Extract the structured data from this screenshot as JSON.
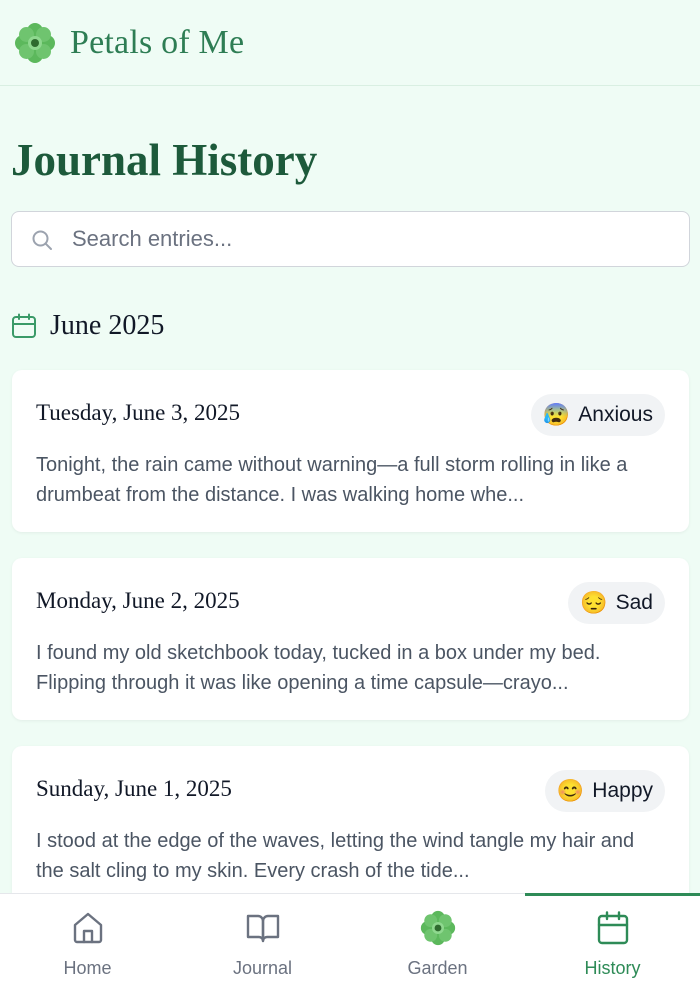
{
  "app": {
    "title": "Petals of Me",
    "logo_icon": "flower-icon"
  },
  "page": {
    "title": "Journal History"
  },
  "search": {
    "placeholder": "Search entries...",
    "value": ""
  },
  "month": {
    "label": "June 2025"
  },
  "entries": [
    {
      "date": "Tuesday, June 3, 2025",
      "mood": {
        "emoji": "😰",
        "label": "Anxious"
      },
      "excerpt_line1": "Tonight, the rain came without warning—a full storm rolling in like a",
      "excerpt_line2": "drumbeat from the distance. I was walking home whe..."
    },
    {
      "date": "Monday, June 2, 2025",
      "mood": {
        "emoji": "😔",
        "label": "Sad"
      },
      "excerpt_line1": "I found my old sketchbook today, tucked in a box under my bed.",
      "excerpt_line2": "Flipping through it was like opening a time capsule—crayo..."
    },
    {
      "date": "Sunday, June 1, 2025",
      "mood": {
        "emoji": "😊",
        "label": "Happy"
      },
      "excerpt_line1": "I stood at the edge of the waves, letting the wind tangle my hair and",
      "excerpt_line2": "the salt cling to my skin. Every crash of the tide..."
    }
  ],
  "nav": {
    "items": [
      {
        "label": "Home",
        "icon": "home-icon"
      },
      {
        "label": "Journal",
        "icon": "book-icon"
      },
      {
        "label": "Garden",
        "icon": "flower-icon"
      },
      {
        "label": "History",
        "icon": "calendar-icon"
      }
    ],
    "active": "History"
  },
  "colors": {
    "background": "#effcf5",
    "accent": "#2e8b57",
    "title": "#1d5a3b"
  }
}
